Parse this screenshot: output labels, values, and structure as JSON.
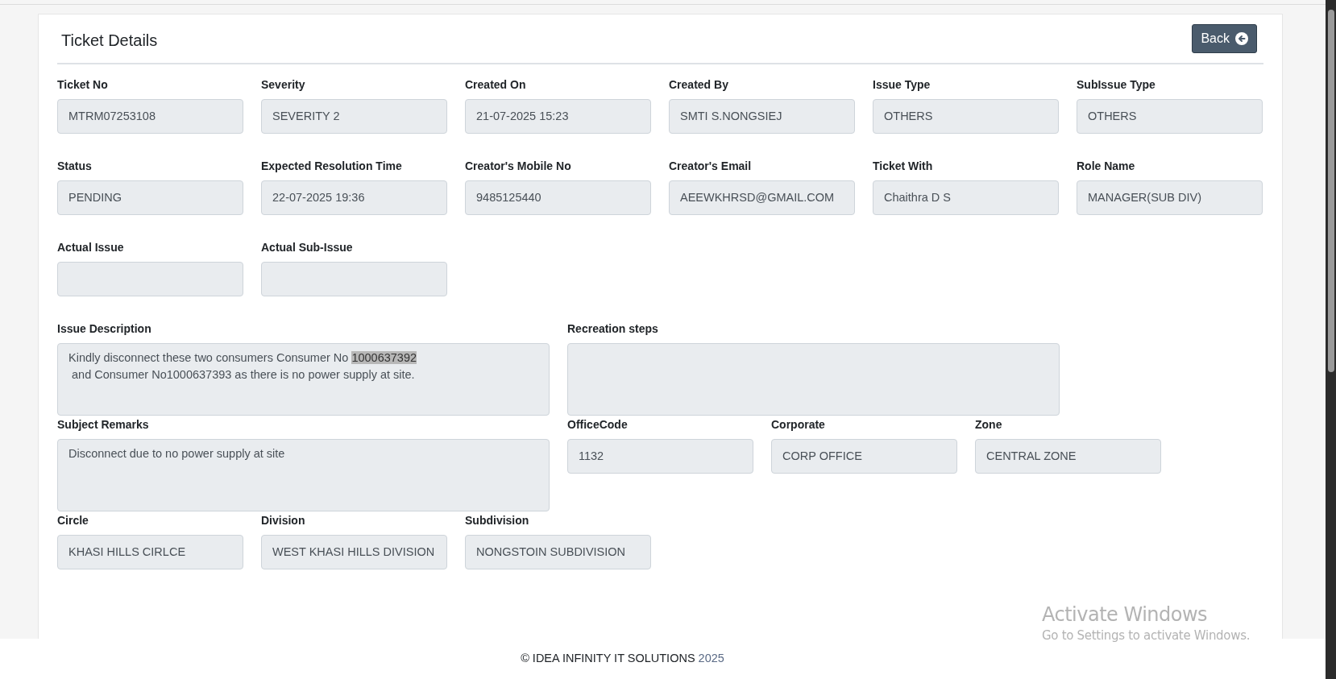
{
  "page": {
    "title": "Ticket Details",
    "back_button": "Back"
  },
  "field_rows": [
    [
      {
        "label": "Ticket No",
        "value": "MTRM07253108"
      },
      {
        "label": "Severity",
        "value": "SEVERITY 2"
      },
      {
        "label": "Created On",
        "value": "21-07-2025 15:23"
      },
      {
        "label": "Created By",
        "value": "SMTI S.NONGSIEJ"
      },
      {
        "label": "Issue Type",
        "value": "OTHERS"
      },
      {
        "label": "SubIssue Type",
        "value": "OTHERS"
      }
    ],
    [
      {
        "label": "Status",
        "value": "PENDING"
      },
      {
        "label": "Expected Resolution Time",
        "value": "22-07-2025 19:36"
      },
      {
        "label": "Creator's Mobile No",
        "value": "9485125440"
      },
      {
        "label": "Creator's Email",
        "value": "AEEWKHRSD@GMAIL.COM"
      },
      {
        "label": "Ticket With",
        "value": "Chaithra D S"
      },
      {
        "label": "Role Name",
        "value": "MANAGER(SUB DIV)"
      }
    ],
    [
      {
        "label": "Actual Issue"
      },
      {
        "label": "Actual Sub-Issue"
      }
    ]
  ],
  "issue_description": {
    "label": "Issue Description",
    "segments": [
      {
        "text": "Kindly disconnect these two consumers Consumer No ",
        "selected": false
      },
      {
        "text": "1000637392",
        "selected": true
      },
      {
        "text": "\n and Consumer No1000637393 as there is no power supply at site.",
        "selected": false
      }
    ]
  },
  "recreation_steps": {
    "label": "Recreation steps"
  },
  "subject_remarks": {
    "label": "Subject Remarks",
    "value": "Disconnect due to no power supply at site"
  },
  "office_fields": [
    {
      "label": "OfficeCode",
      "value": "1132"
    },
    {
      "label": "Corporate",
      "value": "CORP OFFICE"
    },
    {
      "label": "Zone",
      "value": "CENTRAL ZONE"
    }
  ],
  "location_fields": [
    {
      "label": "Circle",
      "value": "KHASI HILLS CIRLCE"
    },
    {
      "label": "Division",
      "value": "WEST KHASI HILLS DIVISION"
    },
    {
      "label": "Subdivision",
      "value": "NONGSTOIN SUBDIVISION"
    }
  ],
  "footer": {
    "text": "© IDEA INFINITY IT SOLUTIONS",
    "year": "2025"
  },
  "os_overlay": {
    "title": "Activate Windows",
    "subtitle": "Go to Settings to activate Windows."
  }
}
